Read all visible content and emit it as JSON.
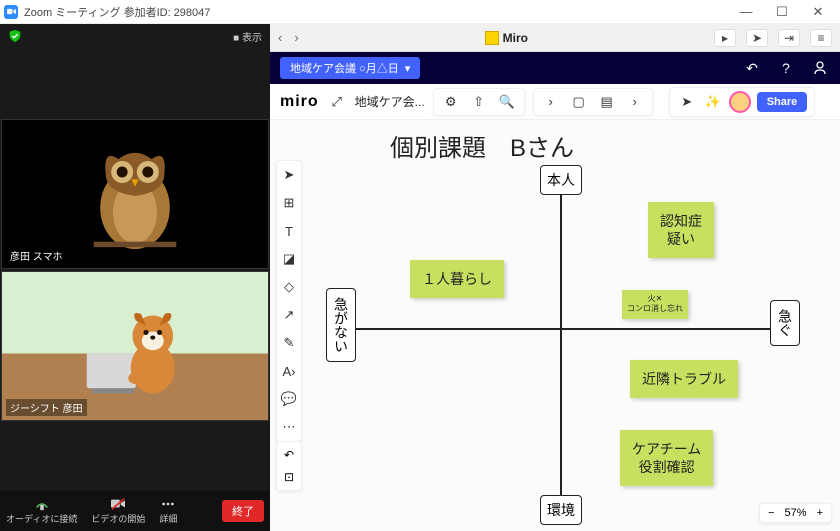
{
  "window": {
    "title": "Zoom ミーティング 参加者ID: 298047"
  },
  "zoom": {
    "view_label": "■ 表示",
    "participants": [
      {
        "name": "彦田 スマホ"
      },
      {
        "name": "ジーシフト 彦田"
      }
    ],
    "controls": {
      "audio": "オーディオに接続",
      "video": "ビデオの開始",
      "more": "詳細",
      "end": "終了"
    }
  },
  "browser": {
    "tab_title": "Miro"
  },
  "miro": {
    "board_chip": "地域ケア会議 ○月△日",
    "logo": "miro",
    "board_name": "地域ケア会...",
    "share": "Share",
    "zoom_level": "57%"
  },
  "canvas": {
    "title": "個別課題　Bさん",
    "axis": {
      "top": "本人",
      "bottom": "環境",
      "left": "急がない",
      "right": "急ぐ"
    },
    "stickies": {
      "alone": "１人暮らし",
      "dementia": "認知症\n疑い",
      "stove": "火✕\nコンロ消し忘れ",
      "neighbor": "近隣トラブル",
      "careteam": "ケアチーム\n役割確認"
    }
  }
}
